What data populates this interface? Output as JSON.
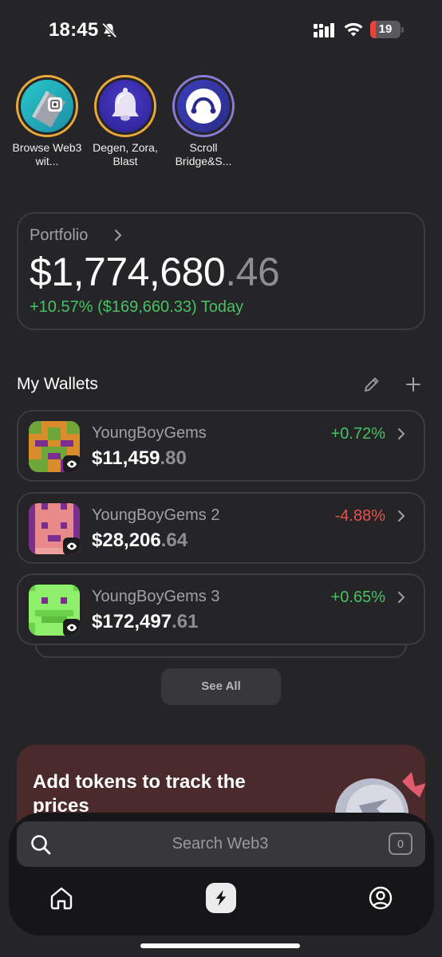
{
  "status_bar": {
    "time": "18:45",
    "icons": [
      "bell-slash-icon",
      "cellular-signal-icon",
      "wifi-icon",
      "battery-icon"
    ],
    "battery_level": "19",
    "battery_color": "#e5453d"
  },
  "stories": [
    {
      "label": "Browse Web3 wit...",
      "icon": "browser-card-icon"
    },
    {
      "label": "Degen, Zora, Blast",
      "icon": "bell-3d-icon"
    },
    {
      "label": "Scroll Bridge&S...",
      "icon": "scroll-bridge-icon"
    }
  ],
  "portfolio": {
    "label": "Portfolio",
    "value_main": "$1,774,680",
    "value_cents": ".46",
    "change": "+10.57% ($169,660.33) Today",
    "change_color": "#47c163"
  },
  "wallets": {
    "title": "My Wallets",
    "items": [
      {
        "name": "YoungBoyGems",
        "balance_main": "$11,459",
        "balance_cents": ".80",
        "change": "+0.72%",
        "change_color": "#47c163"
      },
      {
        "name": "YoungBoyGems 2",
        "balance_main": "$28,206",
        "balance_cents": ".64",
        "change": "-4.88%",
        "change_color": "#e8514b"
      },
      {
        "name": "YoungBoyGems 3",
        "balance_main": "$172,497",
        "balance_cents": ".61",
        "change": "+0.65%",
        "change_color": "#47c163"
      }
    ],
    "see_all_label": "See All"
  },
  "promo": {
    "text": "Add tokens to track the prices"
  },
  "search": {
    "placeholder": "Search Web3",
    "tab_count": "0"
  },
  "nav": {
    "items": [
      "home-icon",
      "lightning-icon",
      "profile-icon"
    ]
  }
}
